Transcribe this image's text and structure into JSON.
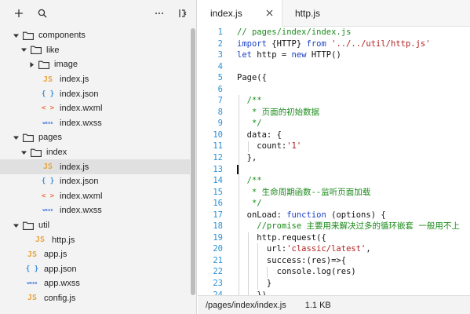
{
  "sidebar": {
    "toolbar": {
      "add_icon": "plus-icon",
      "search_icon": "search-icon",
      "more_icon": "ellipsis-icon",
      "collapse_icon": "split-panel-icon"
    },
    "tree": [
      {
        "label": "components",
        "type": "folder",
        "depth": 0,
        "expanded": true
      },
      {
        "label": "like",
        "type": "folder",
        "depth": 1,
        "expanded": true
      },
      {
        "label": "image",
        "type": "folder",
        "depth": 2,
        "expanded": false
      },
      {
        "label": "index.js",
        "type": "js",
        "depth": 2
      },
      {
        "label": "index.json",
        "type": "json",
        "depth": 2
      },
      {
        "label": "index.wxml",
        "type": "wxml",
        "depth": 2
      },
      {
        "label": "index.wxss",
        "type": "wxss",
        "depth": 2
      },
      {
        "label": "pages",
        "type": "folder",
        "depth": 0,
        "expanded": true
      },
      {
        "label": "index",
        "type": "folder",
        "depth": 1,
        "expanded": true
      },
      {
        "label": "index.js",
        "type": "js",
        "depth": 2,
        "selected": true
      },
      {
        "label": "index.json",
        "type": "json",
        "depth": 2
      },
      {
        "label": "index.wxml",
        "type": "wxml",
        "depth": 2
      },
      {
        "label": "index.wxss",
        "type": "wxss",
        "depth": 2
      },
      {
        "label": "util",
        "type": "folder",
        "depth": 0,
        "expanded": true
      },
      {
        "label": "http.js",
        "type": "js",
        "depth": 1
      },
      {
        "label": "app.js",
        "type": "js",
        "depth": 0
      },
      {
        "label": "app.json",
        "type": "json",
        "depth": 0
      },
      {
        "label": "app.wxss",
        "type": "wxss",
        "depth": 0
      },
      {
        "label": "config.js",
        "type": "js",
        "depth": 0
      }
    ],
    "icon_glyphs": {
      "js": "JS",
      "json": "{ }",
      "wxml": "< >",
      "wxss": "wxss"
    }
  },
  "tabs": [
    {
      "label": "index.js",
      "active": true
    },
    {
      "label": "http.js",
      "active": false
    }
  ],
  "code_lines": [
    {
      "n": "1",
      "tokens": [
        {
          "t": "// pages/index/index.js",
          "c": "cm"
        }
      ]
    },
    {
      "n": "2",
      "tokens": [
        {
          "t": "import",
          "c": "kw"
        },
        {
          "t": " {HTTP} ",
          "c": ""
        },
        {
          "t": "from",
          "c": "kw"
        },
        {
          "t": " ",
          "c": ""
        },
        {
          "t": "'../../util/http.js'",
          "c": "str"
        }
      ]
    },
    {
      "n": "3",
      "tokens": [
        {
          "t": "let",
          "c": "kw"
        },
        {
          "t": " http = ",
          "c": ""
        },
        {
          "t": "new",
          "c": "kw"
        },
        {
          "t": " HTTP()",
          "c": ""
        }
      ]
    },
    {
      "n": "4",
      "tokens": []
    },
    {
      "n": "5",
      "tokens": [
        {
          "t": "Page({",
          "c": ""
        }
      ]
    },
    {
      "n": "6",
      "tokens": []
    },
    {
      "n": "7",
      "tokens": [
        {
          "t": "  /**",
          "c": "cm"
        }
      ]
    },
    {
      "n": "8",
      "tokens": [
        {
          "t": "   * 页面的初始数据",
          "c": "cm"
        }
      ]
    },
    {
      "n": "9",
      "tokens": [
        {
          "t": "   */",
          "c": "cm"
        }
      ]
    },
    {
      "n": "10",
      "tokens": [
        {
          "t": "  data: {",
          "c": ""
        }
      ]
    },
    {
      "n": "11",
      "tokens": [
        {
          "t": "    count:",
          "c": ""
        },
        {
          "t": "'1'",
          "c": "str"
        }
      ]
    },
    {
      "n": "12",
      "tokens": [
        {
          "t": "  },",
          "c": ""
        }
      ]
    },
    {
      "n": "13",
      "tokens": []
    },
    {
      "n": "14",
      "tokens": [
        {
          "t": "  /**",
          "c": "cm"
        }
      ]
    },
    {
      "n": "15",
      "tokens": [
        {
          "t": "   * 生命周期函数--监听页面加载",
          "c": "cm"
        }
      ]
    },
    {
      "n": "16",
      "tokens": [
        {
          "t": "   */",
          "c": "cm"
        }
      ]
    },
    {
      "n": "17",
      "tokens": [
        {
          "t": "  onLoad: ",
          "c": ""
        },
        {
          "t": "function",
          "c": "kw"
        },
        {
          "t": " (options) {",
          "c": ""
        }
      ]
    },
    {
      "n": "18",
      "tokens": [
        {
          "t": "    //promise 主要用来解决过多的循环嵌套 一般用不上",
          "c": "cm"
        }
      ]
    },
    {
      "n": "19",
      "tokens": [
        {
          "t": "    http.request({",
          "c": ""
        }
      ]
    },
    {
      "n": "20",
      "tokens": [
        {
          "t": "      url:",
          "c": ""
        },
        {
          "t": "'classic/latest'",
          "c": "str"
        },
        {
          "t": ",",
          "c": ""
        }
      ]
    },
    {
      "n": "21",
      "tokens": [
        {
          "t": "      success:(res)=>{",
          "c": ""
        }
      ]
    },
    {
      "n": "22",
      "tokens": [
        {
          "t": "        console.log(res)",
          "c": ""
        }
      ]
    },
    {
      "n": "23",
      "tokens": [
        {
          "t": "      }",
          "c": ""
        }
      ]
    },
    {
      "n": "24",
      "tokens": [
        {
          "t": "    })",
          "c": ""
        }
      ]
    }
  ],
  "status": {
    "path": "/pages/index/index.js",
    "size": "1.1 KB"
  }
}
